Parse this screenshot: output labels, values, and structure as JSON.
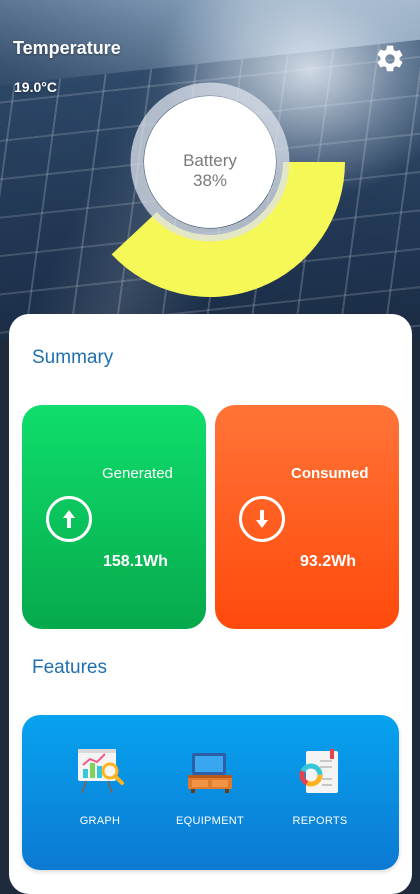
{
  "header": {
    "temperature_title": "Temperature",
    "temperature_value": "19.0°C"
  },
  "battery": {
    "label": "Battery",
    "percent_text": "38%",
    "level": 0.38,
    "fill_color": "#f6f857"
  },
  "summary": {
    "title": "Summary",
    "generated": {
      "label": "Generated",
      "value": "158.1Wh",
      "color": "#0bc75e"
    },
    "consumed": {
      "label": "Consumed",
      "value": "93.2Wh",
      "color": "#ff5a1d"
    }
  },
  "features": {
    "title": "Features",
    "items": [
      {
        "label": "GRAPH",
        "icon": "graph-icon"
      },
      {
        "label": "EQUIPMENT",
        "icon": "equipment-icon"
      },
      {
        "label": "REPORTS",
        "icon": "reports-icon"
      }
    ]
  }
}
